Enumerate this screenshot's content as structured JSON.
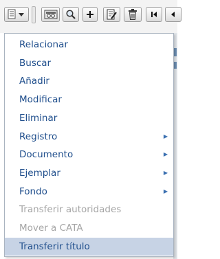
{
  "toolbar": {
    "buttons": [
      {
        "name": "list-menu-icon"
      },
      {
        "name": "view-record-icon"
      },
      {
        "name": "search-icon"
      },
      {
        "name": "plus-icon"
      },
      {
        "name": "edit-document-icon"
      },
      {
        "name": "trash-icon"
      },
      {
        "name": "first-page-icon"
      },
      {
        "name": "previous-page-icon"
      }
    ]
  },
  "menu": {
    "items": [
      {
        "label": "Relacionar",
        "state": "enabled",
        "submenu": false
      },
      {
        "label": "Buscar",
        "state": "enabled",
        "submenu": false
      },
      {
        "label": "Añadir",
        "state": "enabled",
        "submenu": false
      },
      {
        "label": "Modificar",
        "state": "enabled",
        "submenu": false
      },
      {
        "label": "Eliminar",
        "state": "enabled",
        "submenu": false
      },
      {
        "label": "Registro",
        "state": "enabled",
        "submenu": true
      },
      {
        "label": "Documento",
        "state": "enabled",
        "submenu": true
      },
      {
        "label": "Ejemplar",
        "state": "enabled",
        "submenu": true
      },
      {
        "label": "Fondo",
        "state": "enabled",
        "submenu": true
      },
      {
        "label": "Transferir autoridades",
        "state": "disabled",
        "submenu": false
      },
      {
        "label": "Mover a CATA",
        "state": "disabled",
        "submenu": false
      },
      {
        "label": "Transferir título",
        "state": "selected",
        "submenu": false
      }
    ],
    "submenu_arrow": "▶"
  },
  "colors": {
    "menu_text": "#1f4e8c",
    "disabled_text": "#a6a6a6",
    "selected_background": "#c7d3e5",
    "submenu_arrow": "#3a6fb0"
  }
}
